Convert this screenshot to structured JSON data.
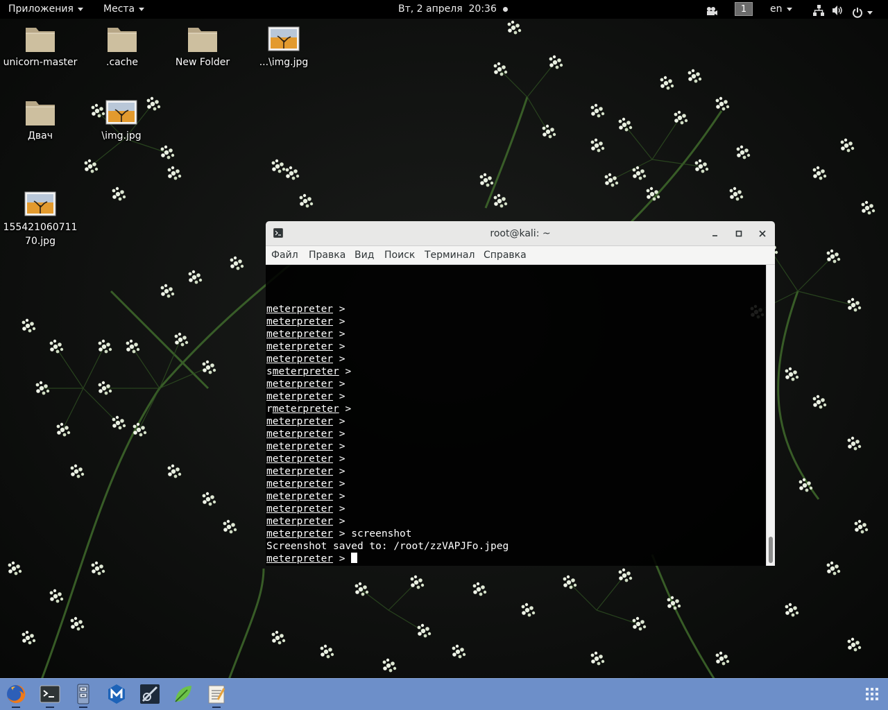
{
  "topbar": {
    "applications_label": "Приложения",
    "places_label": "Места",
    "clock": "Вт, 2 апреля  20:36",
    "workspace": "1",
    "language": "en"
  },
  "desktop": {
    "icons": [
      {
        "label": "unicorn-master",
        "icon": "folder-icon"
      },
      {
        "label": ".cache",
        "icon": "folder-icon"
      },
      {
        "label": "New Folder",
        "icon": "folder-icon"
      },
      {
        "label": "...\\img.jpg",
        "icon": "image-file-icon"
      },
      {
        "label": "Двач",
        "icon": "folder-icon"
      },
      {
        "label": "\\img.jpg",
        "icon": "image-file-icon"
      },
      {
        "label": "15542106071170.jpg",
        "icon": "image-file-icon"
      }
    ]
  },
  "terminal": {
    "title": "root@kali: ~",
    "menu": [
      "Файл",
      "Правка",
      "Вид",
      "Поиск",
      "Терминал",
      "Справка"
    ],
    "lines": [
      {
        "prefix": "",
        "prompt": "meterpreter",
        "rest": " >"
      },
      {
        "prefix": "",
        "prompt": "meterpreter",
        "rest": " >"
      },
      {
        "prefix": "",
        "prompt": "meterpreter",
        "rest": " >"
      },
      {
        "prefix": "",
        "prompt": "meterpreter",
        "rest": " >"
      },
      {
        "prefix": "",
        "prompt": "meterpreter",
        "rest": " >"
      },
      {
        "prefix": "s",
        "prompt": "meterpreter",
        "rest": " >"
      },
      {
        "prefix": "",
        "prompt": "meterpreter",
        "rest": " >"
      },
      {
        "prefix": "",
        "prompt": "meterpreter",
        "rest": " >"
      },
      {
        "prefix": "r",
        "prompt": "meterpreter",
        "rest": " >"
      },
      {
        "prefix": "",
        "prompt": "meterpreter",
        "rest": " >"
      },
      {
        "prefix": "",
        "prompt": "meterpreter",
        "rest": " >"
      },
      {
        "prefix": "",
        "prompt": "meterpreter",
        "rest": " >"
      },
      {
        "prefix": "",
        "prompt": "meterpreter",
        "rest": " >"
      },
      {
        "prefix": "",
        "prompt": "meterpreter",
        "rest": " >"
      },
      {
        "prefix": "",
        "prompt": "meterpreter",
        "rest": " >"
      },
      {
        "prefix": "",
        "prompt": "meterpreter",
        "rest": " >"
      },
      {
        "prefix": "",
        "prompt": "meterpreter",
        "rest": " >"
      },
      {
        "prefix": "",
        "prompt": "meterpreter",
        "rest": " >"
      },
      {
        "prefix": "",
        "prompt": "meterpreter",
        "rest": " > screenshot"
      },
      {
        "prefix": "Screenshot saved to: /root/zzVAPJFo.jpeg",
        "prompt": "",
        "rest": ""
      },
      {
        "prefix": "",
        "prompt": "meterpreter",
        "rest": " > ",
        "cursor": true
      }
    ]
  },
  "dock": {
    "apps": [
      "firefox-icon",
      "terminal-icon",
      "files-icon",
      "maltego-icon",
      "burpsuite-icon",
      "leafpad-icon",
      "text-editor-icon",
      "show-apps-icon"
    ]
  },
  "colors": {
    "dock": "#6d8fc9",
    "topbar": "#000000",
    "terminal_bg": "#000000",
    "terminal_fg": "#ffffff"
  }
}
